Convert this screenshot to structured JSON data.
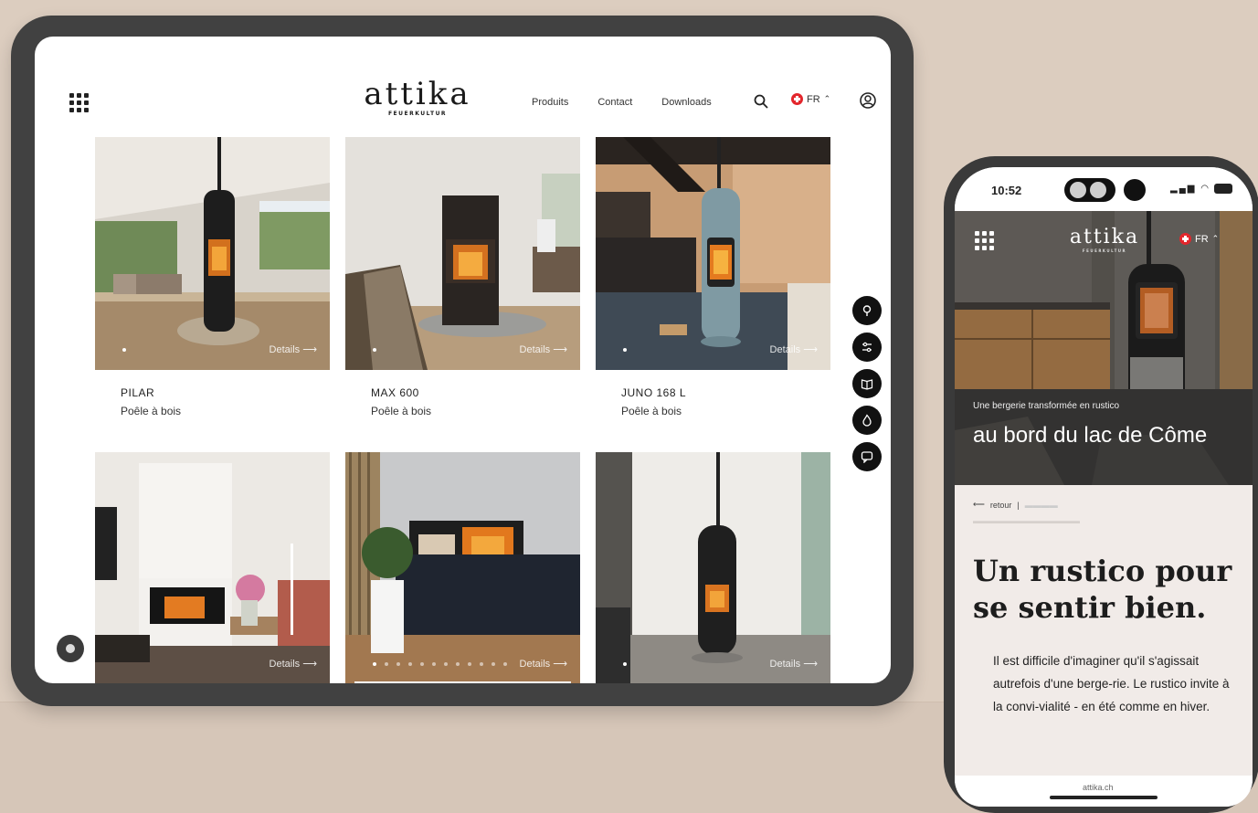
{
  "tablet": {
    "logo": {
      "word": "attika",
      "sub": "FEUERKULTUR"
    },
    "nav": [
      "Produits",
      "Contact",
      "Downloads"
    ],
    "language": "FR",
    "products": [
      {
        "name": "PILAR",
        "type": "Poêle à bois",
        "details": "Details  ⟶"
      },
      {
        "name": "MAX 600",
        "type": "Poêle à bois",
        "details": "Details  ⟶"
      },
      {
        "name": "JUNO 168 L",
        "type": "Poêle à bois",
        "details": "Details  ⟶"
      },
      {
        "details": "Details  ⟶"
      },
      {
        "details": "Details  ⟶"
      },
      {
        "details": "Details  ⟶"
      }
    ]
  },
  "phone": {
    "time": "10:52",
    "logo": {
      "word": "attika",
      "sub": "FEUERKULTUR"
    },
    "language": "FR",
    "hero_subtitle": "Une bergerie transformée en rustico",
    "hero_title": "au bord du lac de Côme",
    "back_label": "retour",
    "heading": "Un rustico pour se sentir bien.",
    "body": "Il est difficile d'imaginer qu'il s'agissait autrefois d'une berge-rie. Le rustico invite à la convi-vialité - en été comme en hiver.",
    "url": "attika.ch"
  },
  "colors": {
    "background": "#dccdbf",
    "device": "#414141",
    "swiss_red": "#e3262c"
  }
}
